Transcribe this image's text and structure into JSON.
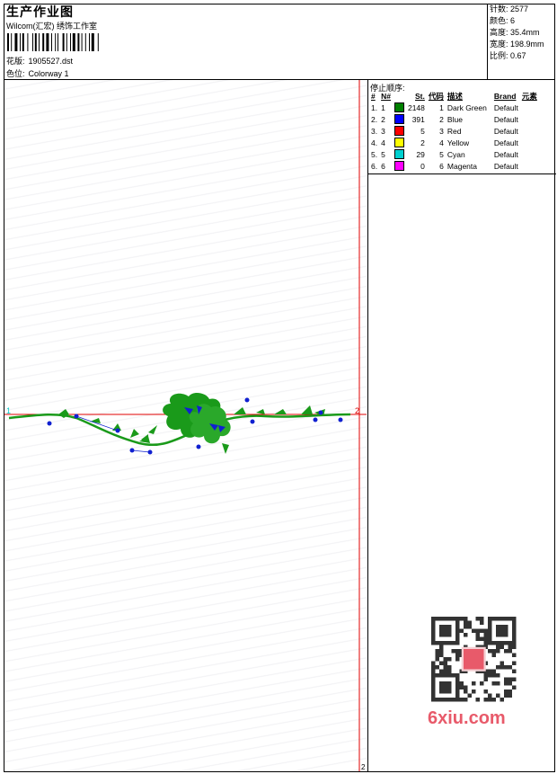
{
  "header": {
    "title": "生产作业图",
    "subtitle": "Wilcom(汇宏) 绣饰工作室",
    "design_file_label": "花版:",
    "design_file": "1905527.dst",
    "colorway_label": "色位:",
    "colorway": "Colorway 1"
  },
  "stats": {
    "stitches": "针数: 2577",
    "colors": "颜色: 6",
    "height": "高度: 35.4mm",
    "width": "宽度: 198.9mm",
    "scale": "比例: 0.67"
  },
  "stop_sequence": {
    "title": "停止顺序:",
    "headers": [
      "#",
      "N#",
      "",
      "St.",
      "代码",
      "描述",
      "Brand",
      "元素"
    ],
    "rows": [
      {
        "idx": "1.",
        "n": "1",
        "color": "#008000",
        "st": "2148",
        "code": "1",
        "desc": "Dark Green",
        "brand": "Default"
      },
      {
        "idx": "2.",
        "n": "2",
        "color": "#0000ff",
        "st": "391",
        "code": "2",
        "desc": "Blue",
        "brand": "Default"
      },
      {
        "idx": "3.",
        "n": "3",
        "color": "#ff0000",
        "st": "5",
        "code": "3",
        "desc": "Red",
        "brand": "Default"
      },
      {
        "idx": "4.",
        "n": "4",
        "color": "#ffff00",
        "st": "2",
        "code": "4",
        "desc": "Yellow",
        "brand": "Default"
      },
      {
        "idx": "5.",
        "n": "5",
        "color": "#00d0d0",
        "st": "29",
        "code": "5",
        "desc": "Cyan",
        "brand": "Default"
      },
      {
        "idx": "6.",
        "n": "6",
        "color": "#ff00ff",
        "st": "0",
        "code": "6",
        "desc": "Magenta",
        "brand": "Default"
      }
    ]
  },
  "canvas": {
    "start_marker": "1",
    "end_marker": "2",
    "corner_marker": "2"
  },
  "watermark": {
    "text": "6xiu.com"
  }
}
